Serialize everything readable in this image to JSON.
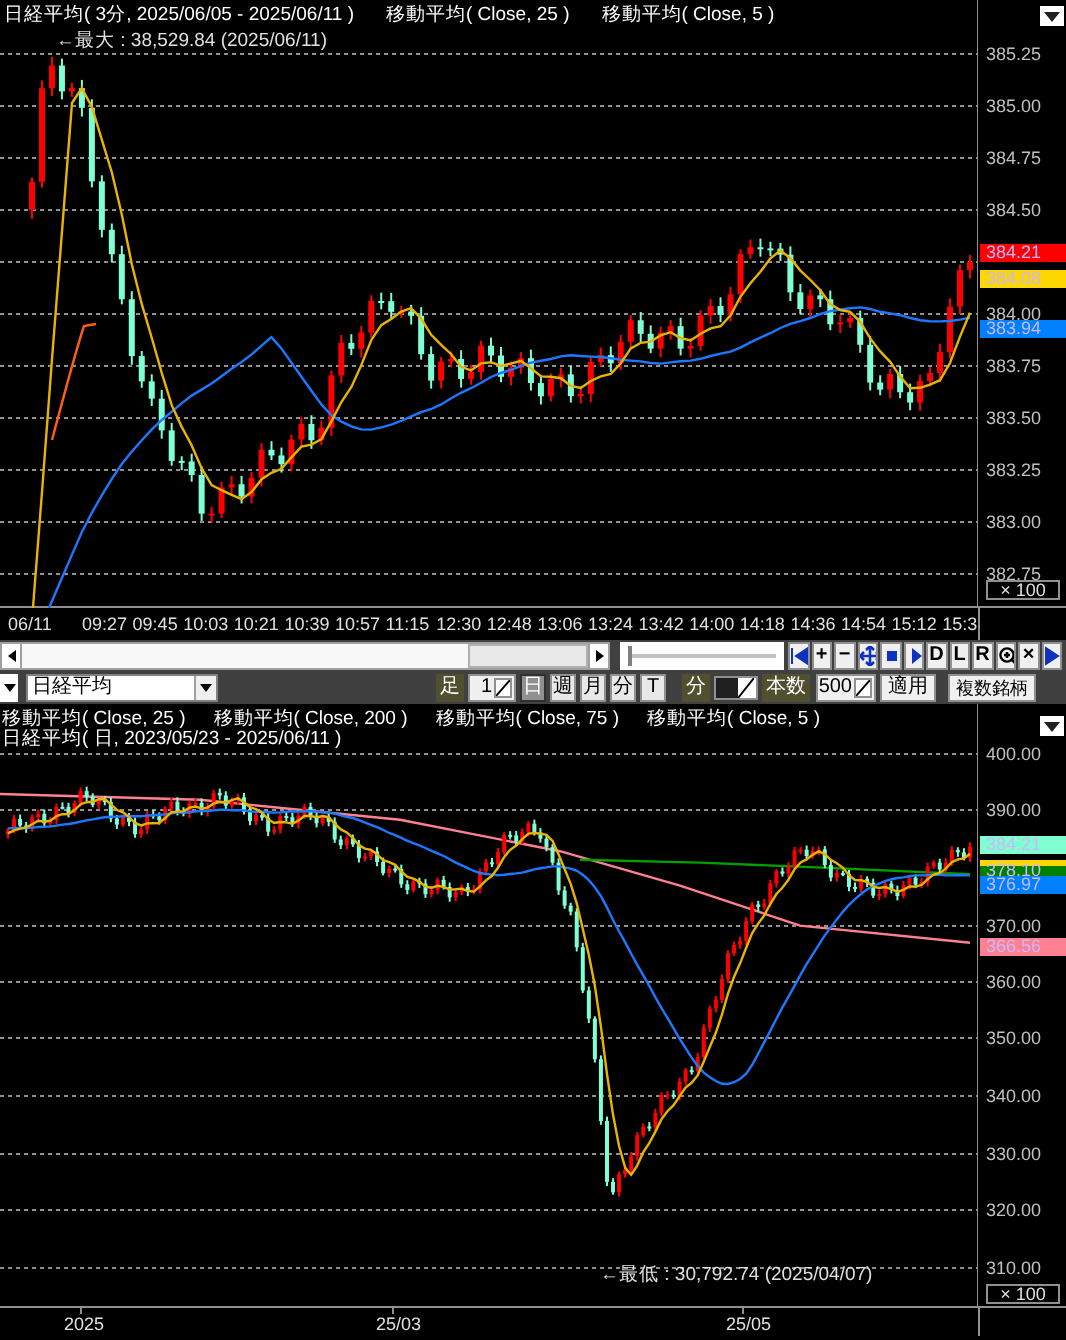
{
  "top_chart": {
    "title": "日経平均( 3分, 2025/06/05 - 2025/06/11 )",
    "indicators": [
      "移動平均( Close, 25 )",
      "移動平均( Close, 5 )"
    ],
    "max_label": "←最大 : 38,529.84 (2025/06/11)",
    "y_ticks": [
      "385.25",
      "385.00",
      "384.75",
      "384.50",
      "384.00",
      "383.75",
      "383.50",
      "383.25",
      "383.00",
      "382.75"
    ],
    "price_tags": [
      {
        "value": "384.21",
        "color": "#ff0000"
      },
      {
        "value": "384.08",
        "color": "#ffd700"
      },
      {
        "value": "383.94",
        "color": "#0080ff"
      }
    ],
    "scale": "× 100",
    "x_labels": [
      "06/11",
      "09:27",
      "09:45",
      "10:03",
      "10:21",
      "10:39",
      "10:57",
      "11:15",
      "12:30",
      "12:48",
      "13:06",
      "13:24",
      "13:42",
      "14:00",
      "14:18",
      "14:36",
      "14:54",
      "15:12",
      "15:3"
    ]
  },
  "zoom_slider": {
    "level": 0.02
  },
  "chart_toolbar": [
    {
      "kind": "first"
    },
    {
      "kind": "text",
      "label": "+"
    },
    {
      "kind": "text",
      "label": "−"
    },
    {
      "kind": "move"
    },
    {
      "kind": "stop"
    },
    {
      "kind": "play"
    },
    {
      "kind": "text",
      "label": "D"
    },
    {
      "kind": "text",
      "label": "L"
    },
    {
      "kind": "text",
      "label": "R"
    },
    {
      "kind": "zoom"
    },
    {
      "kind": "text",
      "label": "×"
    },
    {
      "kind": "last"
    }
  ],
  "settings_bar": {
    "symbol": "日経平均",
    "bar_label": "足",
    "bar_count": "1",
    "periods": [
      {
        "label": "日",
        "selected": true
      },
      {
        "label": "週",
        "selected": false
      },
      {
        "label": "月",
        "selected": false
      },
      {
        "label": "分",
        "selected": false
      },
      {
        "label": "T",
        "selected": false
      }
    ],
    "minute_label": "分",
    "count_label": "本数",
    "count": "500",
    "apply": "適用",
    "multi": "複数銘柄"
  },
  "bottom_chart": {
    "indicators": [
      "移動平均( Close, 25 )",
      "移動平均( Close, 200 )",
      "移動平均( Close, 75 )",
      "移動平均( Close, 5 )"
    ],
    "title": "日経平均( 日, 2023/05/23 - 2025/06/11 )",
    "min_label": "←最低 : 30,792.74 (2025/04/07)",
    "y_ticks": [
      "400.00",
      "390.00",
      "370.00",
      "360.00",
      "350.00",
      "340.00",
      "330.00",
      "320.00",
      "310.00"
    ],
    "price_tags": [
      {
        "value": "384.21",
        "color": "#80ffd0"
      },
      {
        "value": "378.10",
        "color": "#008000"
      },
      {
        "value": "376.97",
        "color": "#0080ff"
      },
      {
        "value": "366.56",
        "color": "#ff8090"
      }
    ],
    "scale": "× 100",
    "x_labels": [
      "2025",
      "25/03",
      "25/05"
    ]
  }
}
